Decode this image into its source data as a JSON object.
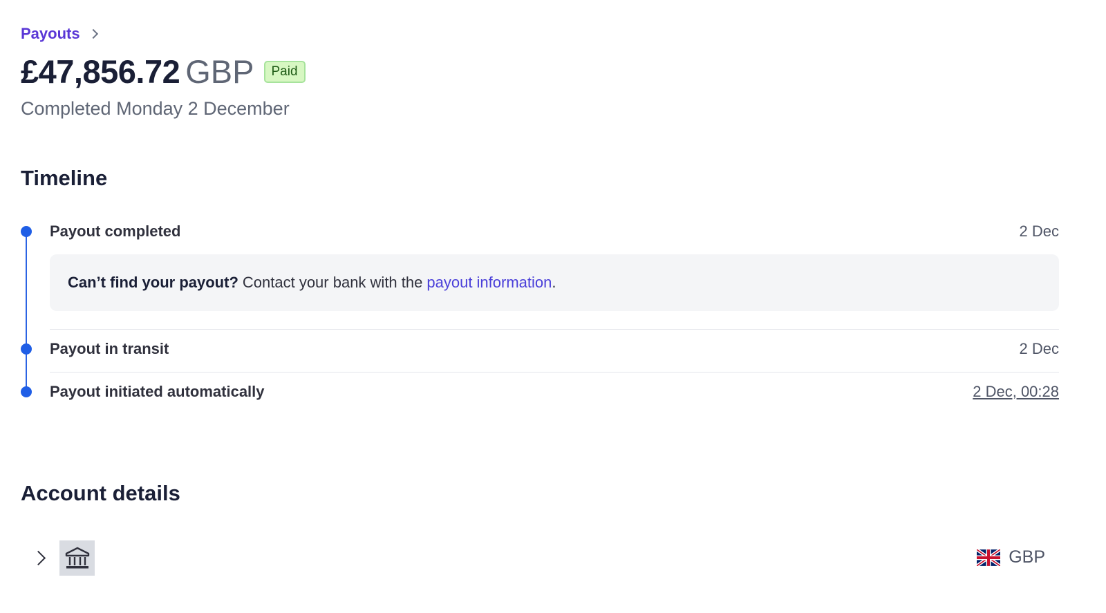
{
  "breadcrumb": {
    "label": "Payouts"
  },
  "header": {
    "amount": "£47,856.72",
    "currency": "GBP",
    "status_badge": "Paid",
    "subtitle": "Completed Monday 2 December"
  },
  "timeline": {
    "title": "Timeline",
    "events": [
      {
        "title": "Payout completed",
        "date": "2 Dec"
      },
      {
        "title": "Payout in transit",
        "date": "2 Dec"
      },
      {
        "title": "Payout initiated automatically",
        "date": "2 Dec, 00:28"
      }
    ],
    "info": {
      "bold": "Can’t find your payout?",
      "text": "Contact your bank with the",
      "link": "payout information",
      "end": "."
    }
  },
  "account": {
    "title": "Account details",
    "currency": "GBP",
    "icons": {
      "expand": "chevron-right-icon",
      "bank": "bank-icon",
      "flag": "uk-flag-icon"
    }
  },
  "colors": {
    "accent": "#5a37d6",
    "timeline": "#1f5ee6",
    "paid_bg": "#d7f7c2",
    "paid_border": "#a7e39c"
  }
}
